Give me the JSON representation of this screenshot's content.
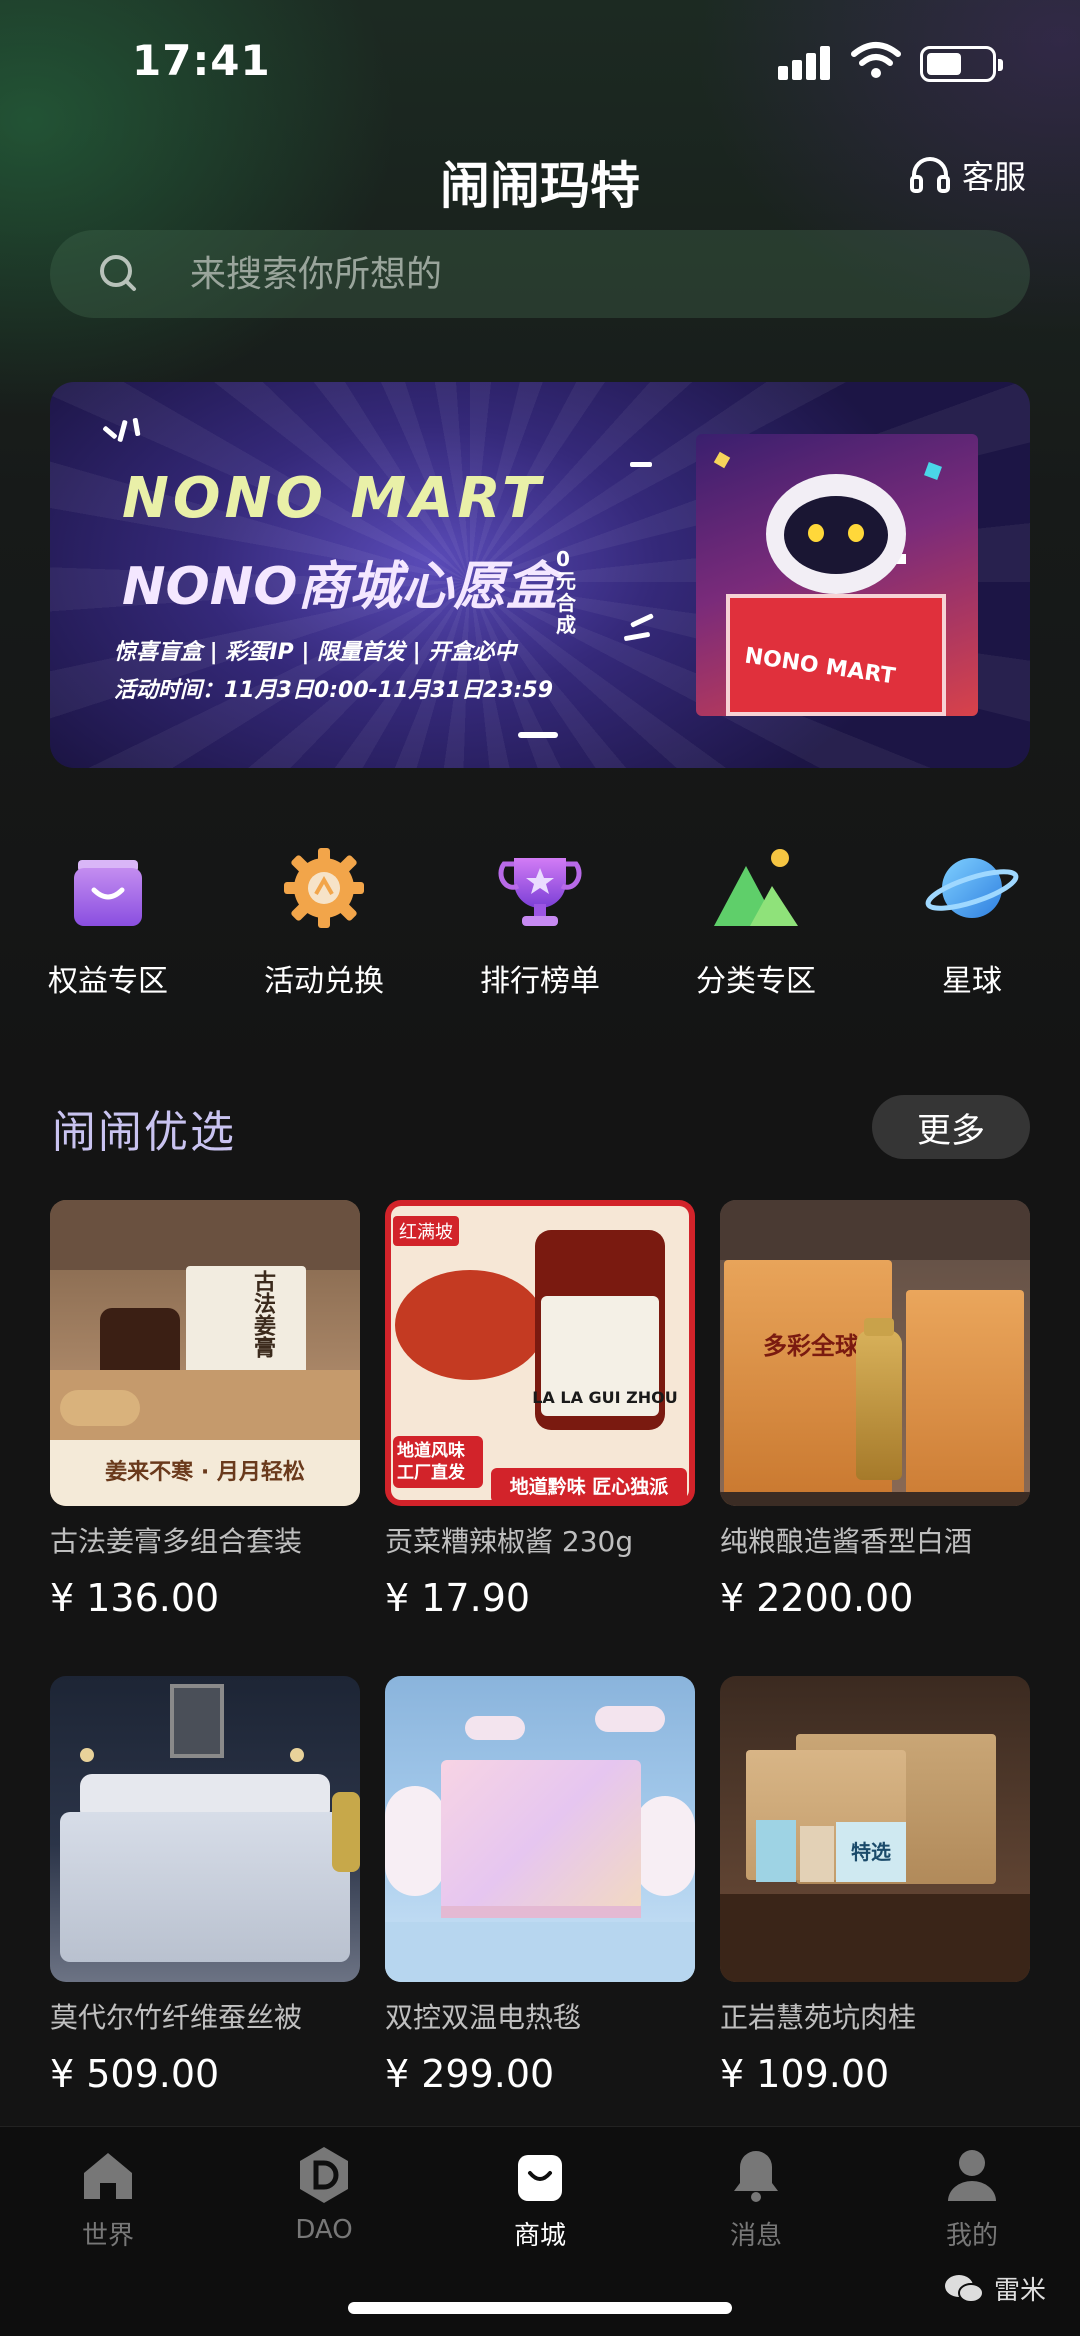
{
  "status_bar": {
    "time": "17:41"
  },
  "header": {
    "title": "闹闹玛特",
    "service_label": "客服"
  },
  "search": {
    "placeholder": "来搜索你所想的"
  },
  "banner": {
    "title_en": "NONO MART",
    "title_cn": "NONO商城心愿盒",
    "tag": "0元合成",
    "subtitle": "惊喜盲盒 | 彩蛋IP | 限量首发 | 开盒必中",
    "time_text": "活动时间：11月3日0:00-11月31日23:59",
    "box_text": "NONO MART"
  },
  "quick_entries": [
    {
      "label": "权益专区",
      "icon": "shopping-bag-icon"
    },
    {
      "label": "活动兑换",
      "icon": "gear-icon"
    },
    {
      "label": "排行榜单",
      "icon": "trophy-icon"
    },
    {
      "label": "分类专区",
      "icon": "mountain-icon"
    },
    {
      "label": "星球",
      "icon": "planet-icon"
    }
  ],
  "section": {
    "title": "闹闹优选",
    "more_label": "更多"
  },
  "products": [
    {
      "name": "古法姜膏多组合套装",
      "price": "¥ 136.00",
      "img_text": "姜来不寒 · 月月轻松",
      "box_text": "古法姜膏"
    },
    {
      "name": "贡菜糟辣椒酱 230g",
      "price": "¥ 17.90",
      "img_text": "地道黔味 匠心独派",
      "badge": "地道风味 工厂直发",
      "jar_text": "LA LA GUI ZHOU",
      "brand": "红满坡"
    },
    {
      "name": "纯粮酿造酱香型白酒",
      "price": "¥ 2200.00",
      "box_text": "多彩全球"
    },
    {
      "name": "莫代尔竹纤维蚕丝被",
      "price": "¥ 509.00"
    },
    {
      "name": "双控双温电热毯",
      "price": "¥ 299.00"
    },
    {
      "name": "正岩慧苑坑肉桂",
      "price": "¥ 109.00",
      "box_text": "特选"
    }
  ],
  "tabbar": [
    {
      "label": "世界",
      "icon": "home-icon",
      "active": false
    },
    {
      "label": "DAO",
      "icon": "dao-icon",
      "active": false
    },
    {
      "label": "商城",
      "icon": "shop-bag-icon",
      "active": true
    },
    {
      "label": "消息",
      "icon": "bell-icon",
      "active": false
    },
    {
      "label": "我的",
      "icon": "user-icon",
      "active": false
    }
  ],
  "watermark": {
    "text": "雷米"
  },
  "colors": {
    "accent_section": "#c9c3f0",
    "search_bg": "#3a5a42",
    "tab_active": "#ffffff",
    "tab_inactive": "#777777"
  }
}
